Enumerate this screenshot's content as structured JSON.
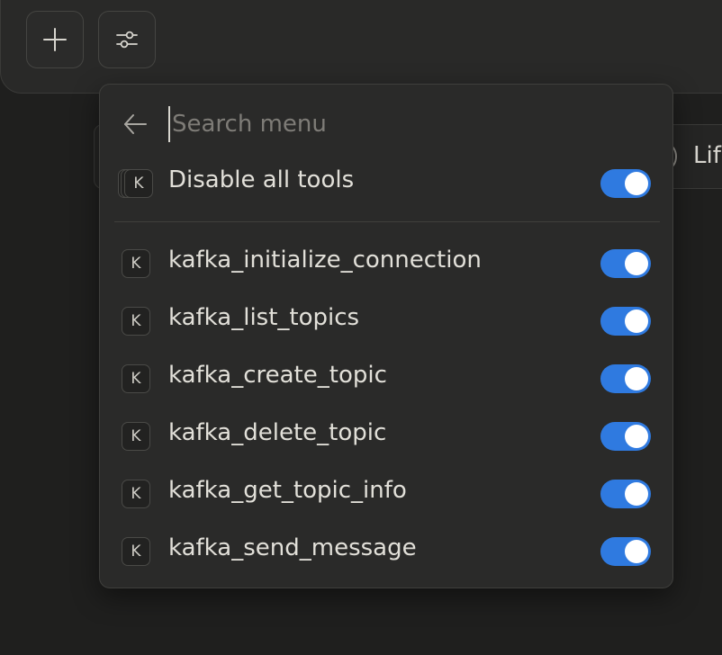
{
  "colors": {
    "toggle_on": "#2f7ae0",
    "menu_bg": "#2a2a29",
    "page_bg": "#1f1f1e"
  },
  "composer": {
    "add_button_icon": "plus-icon",
    "tools_button_icon": "sliders-icon"
  },
  "background": {
    "chip_text": "Lif"
  },
  "menu": {
    "search": {
      "placeholder": "Search menu",
      "value": ""
    },
    "disable_all": {
      "badge": "K",
      "label": "Disable all tools",
      "enabled": true
    },
    "tools": [
      {
        "badge": "K",
        "label": "kafka_initialize_connection",
        "enabled": true
      },
      {
        "badge": "K",
        "label": "kafka_list_topics",
        "enabled": true
      },
      {
        "badge": "K",
        "label": "kafka_create_topic",
        "enabled": true
      },
      {
        "badge": "K",
        "label": "kafka_delete_topic",
        "enabled": true
      },
      {
        "badge": "K",
        "label": "kafka_get_topic_info",
        "enabled": true
      },
      {
        "badge": "K",
        "label": "kafka_send_message",
        "enabled": true
      }
    ]
  }
}
